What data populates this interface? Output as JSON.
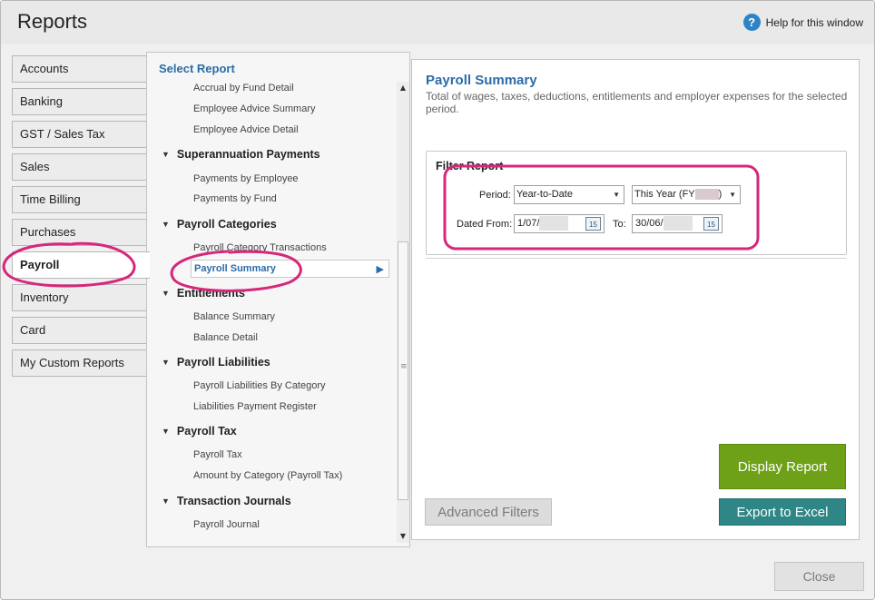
{
  "window": {
    "title": "Reports",
    "help_label": "Help for this window",
    "help_icon": "question-icon"
  },
  "tabs": [
    {
      "label": "Accounts"
    },
    {
      "label": "Banking"
    },
    {
      "label": "GST / Sales Tax"
    },
    {
      "label": "Sales"
    },
    {
      "label": "Time Billing"
    },
    {
      "label": "Purchases"
    },
    {
      "label": "Payroll",
      "active": true
    },
    {
      "label": "Inventory"
    },
    {
      "label": "Card"
    },
    {
      "label": "My Custom Reports"
    }
  ],
  "report_list": {
    "heading": "Select Report",
    "top_items": [
      "Accrual by Fund Detail",
      "Employee Advice Summary",
      "Employee Advice Detail"
    ],
    "categories": [
      {
        "name": "Superannuation Payments",
        "items": [
          "Payments by Employee",
          "Payments by Fund"
        ]
      },
      {
        "name": "Payroll Categories",
        "items": [
          "Payroll Category Transactions",
          "Payroll Summary"
        ]
      },
      {
        "name": "Entitlements",
        "items": [
          "Balance Summary",
          "Balance Detail"
        ]
      },
      {
        "name": "Payroll Liabilities",
        "items": [
          "Payroll Liabilities By Category",
          "Liabilities Payment Register"
        ]
      },
      {
        "name": "Payroll Tax",
        "items": [
          "Payroll Tax",
          "Amount by Category (Payroll Tax)"
        ]
      },
      {
        "name": "Transaction Journals",
        "items": [
          "Payroll Journal"
        ]
      }
    ],
    "selected": "Payroll Summary"
  },
  "detail": {
    "title": "Payroll Summary",
    "description": "Total of wages, taxes, deductions, entitlements and employer expenses for the selected period."
  },
  "filter": {
    "heading": "Filter Report",
    "period_label": "Period:",
    "period_value": "Year-to-Date",
    "year_value_prefix": "This Year (FY",
    "year_value_suffix": ")",
    "dated_from_label": "Dated From:",
    "dated_from_value": "1/07/",
    "to_label": "To:",
    "to_value": "30/06/",
    "calendar_day": "15"
  },
  "buttons": {
    "display": "Display Report",
    "export": "Export to Excel",
    "advanced": "Advanced Filters",
    "close": "Close"
  },
  "colors": {
    "accent_blue": "#2b6ca8",
    "display_green": "#6ea118",
    "export_teal": "#2f8686",
    "annotation_magenta": "#d6277a"
  }
}
